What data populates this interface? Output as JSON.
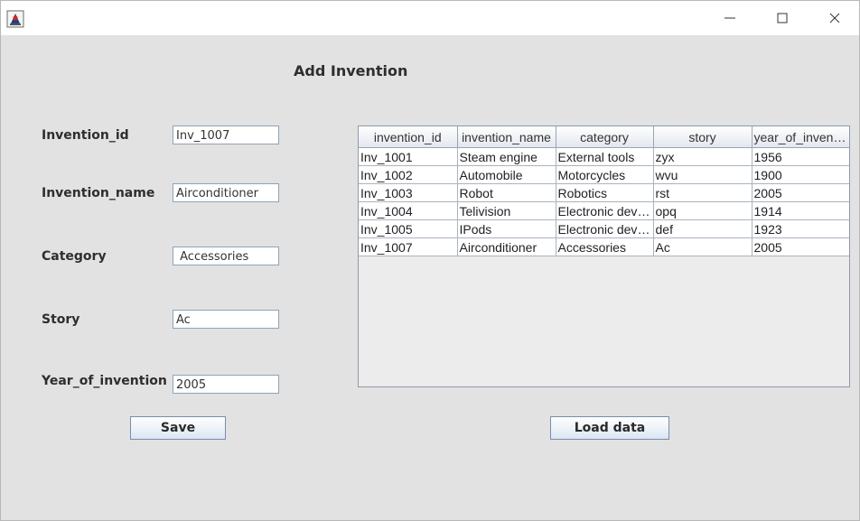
{
  "titlebar": {
    "app_icon": "java-duke-icon",
    "controls": {
      "minimize": "minimize-icon",
      "maximize": "maximize-icon",
      "close": "close-icon"
    }
  },
  "form": {
    "heading": "Add Invention",
    "fields": [
      {
        "label": "Invention_id",
        "value": "Inv_1007"
      },
      {
        "label": "Invention_name",
        "value": "Airconditioner"
      },
      {
        "label": "Category",
        "value": " Accessories"
      },
      {
        "label": "Story",
        "value": "Ac"
      },
      {
        "label": "Year_of_invention",
        "value": "2005"
      }
    ],
    "save_label": "Save"
  },
  "table": {
    "columns": [
      "invention_id",
      "invention_name",
      "category",
      "story",
      "year_of_invention"
    ],
    "rows": [
      [
        "Inv_1001",
        "Steam engine",
        "External tools",
        "zyx",
        "1956"
      ],
      [
        "Inv_1002",
        "Automobile",
        "Motorcycles",
        "wvu",
        "1900"
      ],
      [
        "Inv_1003",
        "Robot",
        "Robotics",
        "rst",
        "2005"
      ],
      [
        "Inv_1004",
        "Telivision",
        "Electronic devices",
        "opq",
        "1914"
      ],
      [
        "Inv_1005",
        "IPods",
        "Electronic devices",
        "def",
        "1923"
      ],
      [
        "Inv_1007",
        "Airconditioner",
        " Accessories",
        "Ac",
        "2005"
      ]
    ]
  },
  "load_label": "Load data"
}
